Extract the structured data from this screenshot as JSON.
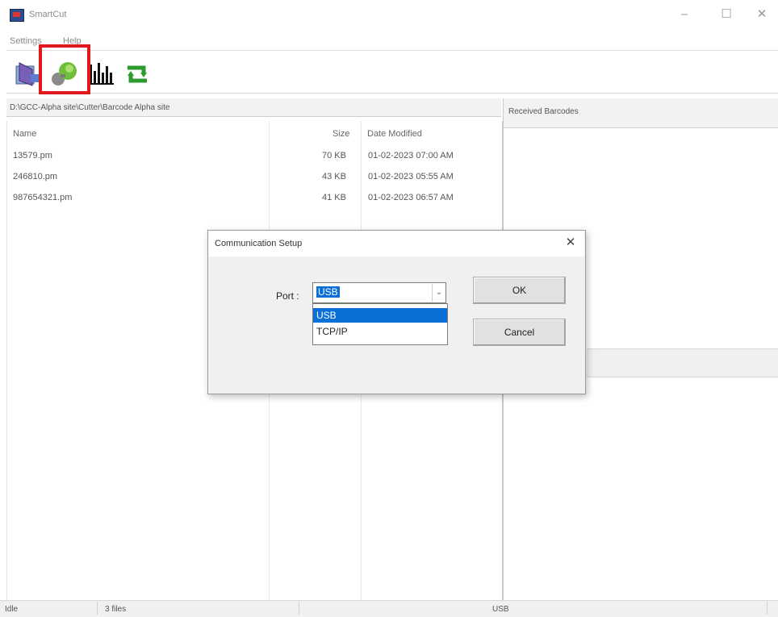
{
  "window": {
    "title": "SmartCut",
    "minimize_glyph": "–",
    "maximize_glyph": "☐",
    "close_glyph": "✕"
  },
  "menu": {
    "items": [
      {
        "label": "Settings"
      },
      {
        "label": "Help"
      }
    ]
  },
  "toolbar": {
    "buttons": [
      {
        "icon": "open-folder-icon"
      },
      {
        "icon": "communication-setup-icon",
        "highlighted": true
      },
      {
        "icon": "barcode-icon"
      },
      {
        "icon": "refresh-icon"
      }
    ],
    "highlight_color": "#e0191c"
  },
  "file_browser": {
    "path": "D:\\GCC-Alpha site\\Cutter\\Barcode Alpha site",
    "columns": {
      "name": "Name",
      "size": "Size",
      "date": "Date Modified"
    },
    "rows": [
      {
        "name": "13579.pm",
        "size": "70 KB",
        "date": "01-02-2023 07:00 AM"
      },
      {
        "name": "246810.pm",
        "size": "43 KB",
        "date": "01-02-2023 05:55 AM"
      },
      {
        "name": "987654321.pm",
        "size": "41 KB",
        "date": "01-02-2023 06:57 AM"
      }
    ]
  },
  "received_panel": {
    "label": "Received Barcodes"
  },
  "status_bar": {
    "state": "Idle",
    "file_count": "3 files",
    "connection": "USB"
  },
  "dialog": {
    "title": "Communication Setup",
    "close_glyph": "✕",
    "port_label": "Port :",
    "port_value": "USB",
    "dropdown_arrow": "⌄",
    "options": [
      "USB",
      "TCP/IP"
    ],
    "ok_label": "OK",
    "cancel_label": "Cancel",
    "selection_color": "#0a6fd6"
  }
}
